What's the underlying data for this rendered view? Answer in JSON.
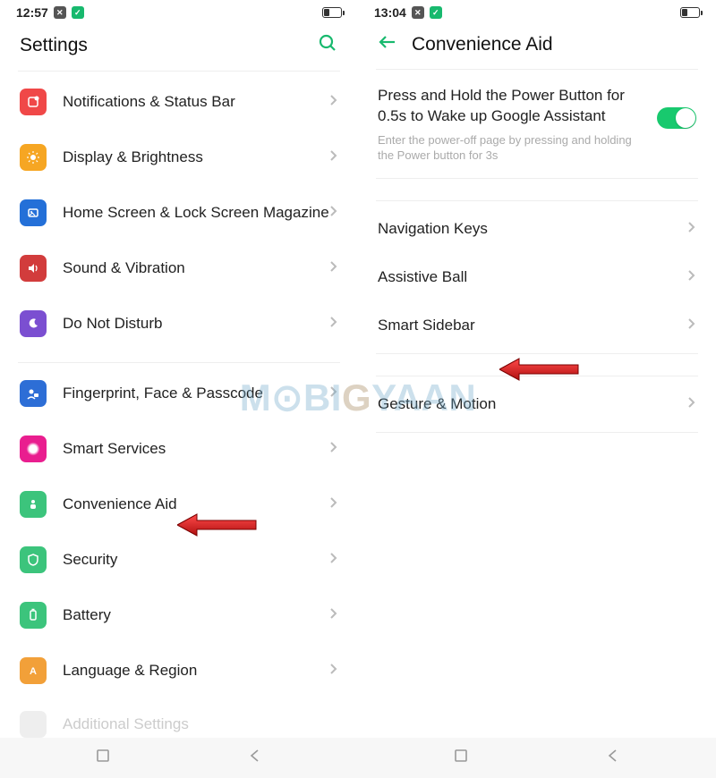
{
  "watermark": "MOBIGYAAN",
  "left_phone": {
    "status": {
      "time": "12:57"
    },
    "header": {
      "title": "Settings"
    },
    "rows": [
      {
        "icon": "notifications-icon",
        "color": "ic-red",
        "label": "Notifications & Status Bar"
      },
      {
        "icon": "display-icon",
        "color": "ic-orange",
        "label": "Display & Brightness"
      },
      {
        "icon": "home-screen-icon",
        "color": "ic-blue",
        "label": "Home Screen & Lock Screen Magazine"
      },
      {
        "icon": "sound-icon",
        "color": "ic-dkred",
        "label": "Sound & Vibration"
      },
      {
        "icon": "dnd-icon",
        "color": "ic-purple",
        "label": "Do Not Disturb"
      }
    ],
    "rows2": [
      {
        "icon": "fingerprint-icon",
        "color": "ic-dkblue",
        "label": "Fingerprint, Face & Passcode"
      },
      {
        "icon": "smart-services-icon",
        "color": "ic-magenta",
        "label": "Smart Services"
      },
      {
        "icon": "convenience-aid-icon",
        "color": "ic-green",
        "label": "Convenience Aid",
        "highlight": true
      },
      {
        "icon": "security-icon",
        "color": "ic-green2",
        "label": "Security"
      },
      {
        "icon": "battery-icon",
        "color": "ic-green3",
        "label": "Battery"
      },
      {
        "icon": "language-icon",
        "color": "ic-amber",
        "label": "Language & Region"
      }
    ],
    "cutoff": "Additional Settings"
  },
  "right_phone": {
    "status": {
      "time": "13:04"
    },
    "header": {
      "title": "Convenience Aid"
    },
    "toggle": {
      "title": "Press and Hold the Power Button for 0.5s to Wake up Google Assistant",
      "subtitle": "Enter the power-off page by pressing and holding the Power button for 3s",
      "on": true
    },
    "rows": [
      {
        "label": "Navigation Keys"
      },
      {
        "label": "Assistive Ball"
      },
      {
        "label": "Smart Sidebar",
        "highlight": true
      }
    ],
    "rows2": [
      {
        "label": "Gesture & Motion"
      }
    ]
  }
}
